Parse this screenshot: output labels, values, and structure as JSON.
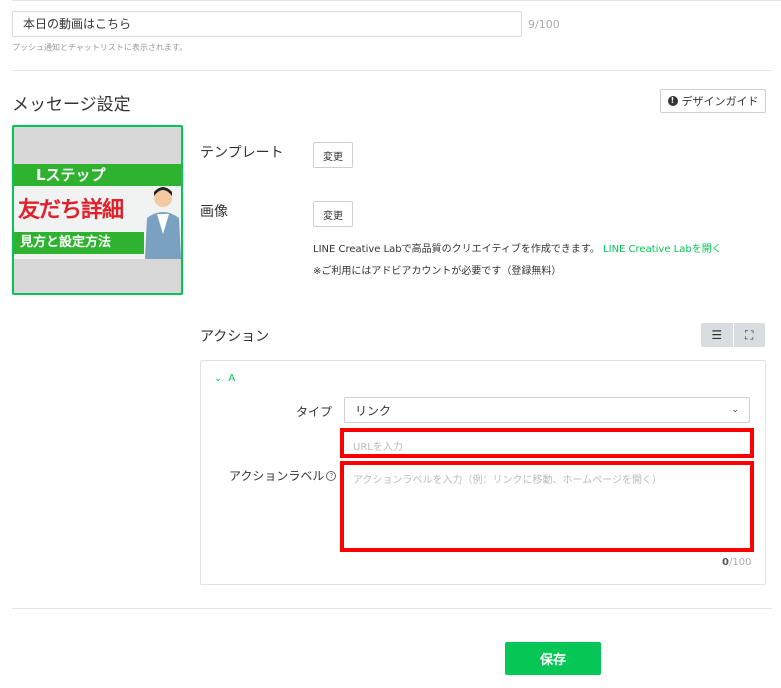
{
  "alt_text": {
    "value": "本日の動画はこちら",
    "count": "9/100",
    "help": "プッシュ通知とチャットリストに表示されます。"
  },
  "message_settings": {
    "title": "メッセージ設定",
    "design_guide_label": "デザインガイド"
  },
  "preview": {
    "line1": "Lステップ",
    "line2": "友だち詳細",
    "line3": "見方と設定方法"
  },
  "template": {
    "label": "テンプレート",
    "change_label": "変更"
  },
  "image": {
    "label": "画像",
    "change_label": "変更",
    "note_text": "LINE Creative Labで高品質のクリエイティブを作成できます。",
    "note_link": "LINE Creative Labを開く",
    "note2": "※ご利用にはアドビアカウントが必要です（登録無料）"
  },
  "action": {
    "title": "アクション",
    "toggle_label": "A",
    "type_label": "タイプ",
    "type_value": "リンク",
    "url_placeholder": "URLを入力",
    "action_label_label": "アクションラベル",
    "action_label_placeholder": "アクションラベルを入力（例：リンクに移動、ホームページを開く）",
    "count_current": "0",
    "count_max": "/100"
  },
  "save_label": "保存",
  "colors": {
    "accent": "#06c755",
    "highlight": "#ff0000"
  }
}
